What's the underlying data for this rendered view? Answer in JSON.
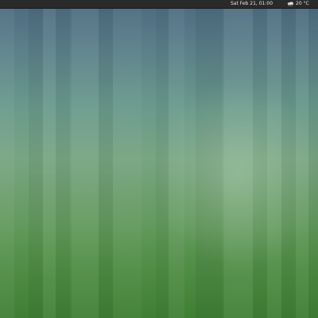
{
  "topbar": {
    "clock": "Sat Feb 21, 01:00",
    "weather": {
      "icon": "cloud-rain-icon",
      "temperature": "20 °C"
    }
  },
  "colors": {
    "topbar": "#2a2a2a",
    "wallpaper_top": "#4c6980",
    "wallpaper_bottom": "#3f7f34"
  }
}
